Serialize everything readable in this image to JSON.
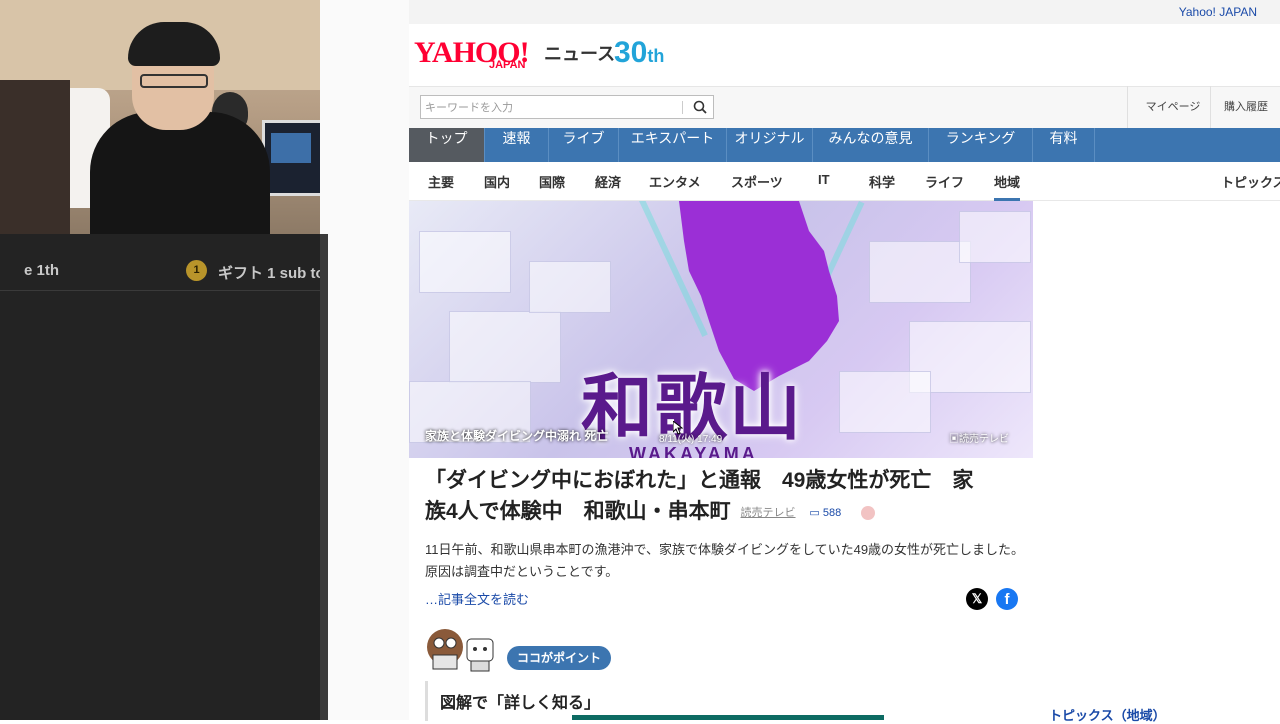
{
  "stream": {
    "ticker_left": "e 1th",
    "ticker_badge": "1",
    "ticker_right": "ギフト 1 sub to"
  },
  "header": {
    "top_link": "Yahoo! JAPAN",
    "logo_yahoo": "YAHOO!",
    "logo_japan": "JAPAN",
    "logo_news": "ニュース",
    "logo_anniv_num": "30",
    "logo_anniv_suffix": "th"
  },
  "search": {
    "placeholder": "キーワードを入力",
    "mypage": "マイページ",
    "purchase": "購入履歴"
  },
  "main_nav": [
    {
      "label": "トップ",
      "active": true
    },
    {
      "label": "速報"
    },
    {
      "label": "ライブ"
    },
    {
      "label": "エキスパート"
    },
    {
      "label": "オリジナル"
    },
    {
      "label": "みんなの意見"
    },
    {
      "label": "ランキング"
    },
    {
      "label": "有料"
    }
  ],
  "sub_nav": [
    {
      "label": "主要"
    },
    {
      "label": "国内"
    },
    {
      "label": "国際"
    },
    {
      "label": "経済"
    },
    {
      "label": "エンタメ"
    },
    {
      "label": "スポーツ"
    },
    {
      "label": "IT"
    },
    {
      "label": "科学"
    },
    {
      "label": "ライフ"
    },
    {
      "label": "地域",
      "active": true
    },
    {
      "label": "トピックス"
    }
  ],
  "article": {
    "hero_title": "和歌山",
    "hero_subtitle": "WAKAYAMA",
    "hero_caption": "家族と体験ダイビング中溺れ 死亡",
    "hero_time": "8/11(火) 17:49",
    "hero_source": "読売テレビ",
    "headline_line1": "「ダイビング中におぼれた」と通報　49歳女性が死亡　家",
    "headline_line2": "族4人で体験中　和歌山・串本町",
    "source": "読売テレビ",
    "comments": "588",
    "summary": "11日午前、和歌山県串本町の漁港沖で、家族で体験ダイビングをしていた49歳の女性が死亡しました。原因は調査中だということです。",
    "read_more": "…記事全文を読む",
    "share_x": "𝕏",
    "share_fb": "f",
    "point_badge": "ココがポイント",
    "zukai_title": "図解で「詳しく知る」"
  },
  "sidebar": {
    "topics_heading": "トピックス（地域）"
  },
  "colors": {
    "nav_blue": "#3c75b0",
    "nav_active": "#555a60",
    "brand_red": "#ff0033",
    "link_blue": "#1a4aa8"
  }
}
